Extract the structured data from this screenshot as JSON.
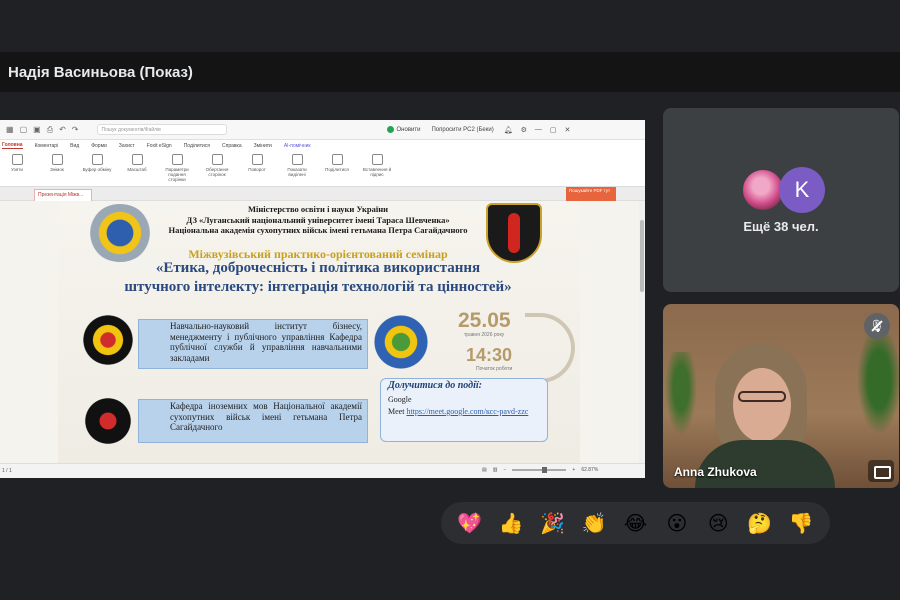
{
  "presenter": {
    "name": "Надія Васиньова (Показ)"
  },
  "app": {
    "search_placeholder": "Пошук документів/Файлів",
    "update_label": "Оновити",
    "recommend_label": "Попросити PC2 (Беки)",
    "menu": [
      "Головна",
      "Коментарі",
      "Вид",
      "Форми",
      "Захист",
      "Foxit eSign",
      "Поділитися",
      "Справка",
      "Змінити",
      "AI-помічник"
    ],
    "ribbon": [
      "Узяти",
      "Знімок",
      "Буфер обміну",
      "Масштаб",
      "Параметри подання сторінки",
      "Обертання сторінок",
      "Поворот",
      "Показати виділені",
      "Поділитися",
      "Вставлення й підпис"
    ],
    "doc_tab": "Презентація Міжв...",
    "notice": "Пошукайте PDF тут",
    "page_indicator": "1 / 1",
    "zoom": "62.87%"
  },
  "slide": {
    "header_lines": [
      "Міністерство освіти і науки України",
      "ДЗ «Луганський національний університет імені Тараса Шевченка»",
      "Національна академія сухопутних військ імені гетьмана Петра Сагайдачного"
    ],
    "seminar_title": "Міжвузівський практико-орієнтований семінар",
    "topic_line1": "«Етика, доброчесність і політика використання",
    "topic_line2": "штучного інтелекту: інтеграція технологій та цінностей»",
    "org1": "Навчально-науковий інститут бізнесу, менеджменту і публічного управління Кафедра публічної служби й управління навчальними закладами",
    "org2": "Кафедра іноземних мов Національної академії сухопутних військ імені гетьмана Петра Сагайдачного",
    "date": "25.05",
    "date_sub": "травня 2026 року",
    "time": "14:30",
    "time_sub": "Початок роботи",
    "join_title": "Долучитися до події:",
    "join_platform": "Google",
    "join_prefix": "Meet",
    "join_link": "https://meet.google.com/ксс-pavd-zzc"
  },
  "participants": {
    "avatar_letter": "K",
    "more_label": "Ещё 38 чел.",
    "speaker_name": "Anna Zhukova"
  },
  "reactions": [
    "💖",
    "👍",
    "🎉",
    "👏",
    "😂",
    "😮",
    "😢",
    "🤔",
    "👎"
  ]
}
